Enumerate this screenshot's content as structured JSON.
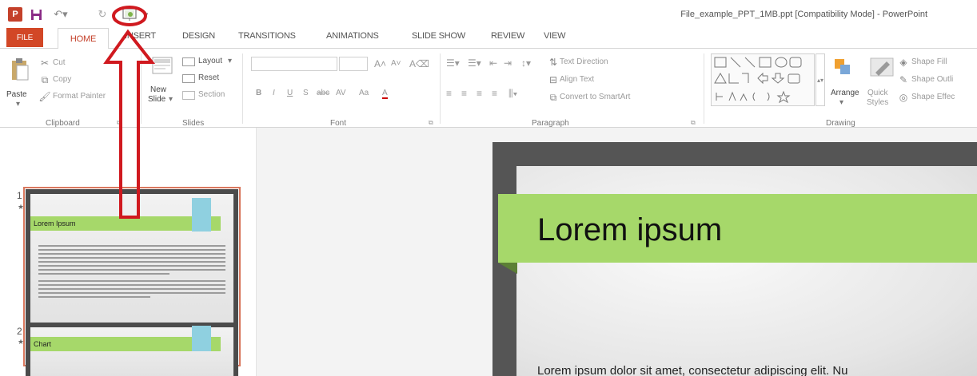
{
  "window": {
    "title": "File_example_PPT_1MB.ppt [Compatibility Mode] - PowerPoint"
  },
  "tabs": [
    {
      "label": "FILE"
    },
    {
      "label": "HOME"
    },
    {
      "label": "INSERT"
    },
    {
      "label": "DESIGN"
    },
    {
      "label": "TRANSITIONS"
    },
    {
      "label": "ANIMATIONS"
    },
    {
      "label": "SLIDE SHOW"
    },
    {
      "label": "REVIEW"
    },
    {
      "label": "VIEW"
    }
  ],
  "ribbon": {
    "clipboard": {
      "paste": "Paste",
      "cut": "Cut",
      "copy": "Copy",
      "format_painter": "Format Painter",
      "group": "Clipboard"
    },
    "slides": {
      "new_slide_1": "New",
      "new_slide_2": "Slide",
      "layout": "Layout",
      "reset": "Reset",
      "section": "Section",
      "group": "Slides"
    },
    "font": {
      "group": "Font",
      "bold": "B",
      "italic": "I",
      "underline": "U",
      "shadow": "S",
      "strike": "abc",
      "spacing": "AV",
      "case": "Aa",
      "color": "A"
    },
    "paragraph": {
      "text_direction": "Text Direction",
      "align_text": "Align Text",
      "convert_smartart": "Convert to SmartArt",
      "group": "Paragraph"
    },
    "drawing": {
      "arrange": "Arrange",
      "quick_1": "Quick",
      "quick_2": "Styles",
      "shape_fill": "Shape Fill",
      "shape_outline": "Shape Outli",
      "shape_effects": "Shape Effec",
      "group": "Drawing"
    }
  },
  "thumbnails": [
    {
      "number": "1",
      "title": "Lorem Ipsum"
    },
    {
      "number": "2",
      "title": "Chart"
    }
  ],
  "slide": {
    "title": "Lorem ipsum",
    "body": "Lorem ipsum dolor sit amet, consectetur adipiscing elit. Nu"
  },
  "colors": {
    "accent_file": "#d24726",
    "green_band": "#a6d86a",
    "annotation_red": "#d0191f"
  }
}
